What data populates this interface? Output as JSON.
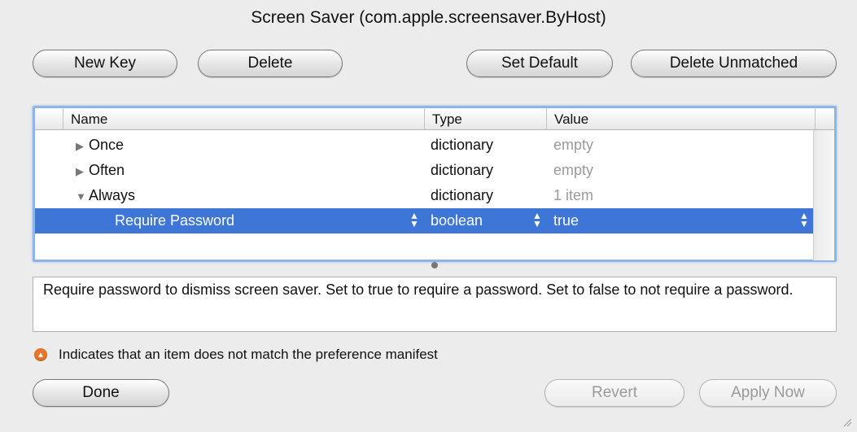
{
  "window": {
    "title": "Screen Saver (com.apple.screensaver.ByHost)"
  },
  "toolbar": {
    "new_key": "New Key",
    "delete": "Delete",
    "set_default": "Set Default",
    "delete_unmatched": "Delete Unmatched"
  },
  "table": {
    "columns": {
      "name": "Name",
      "type": "Type",
      "value": "Value"
    },
    "rows": [
      {
        "name": "Once",
        "type": "dictionary",
        "value": "empty",
        "expander": "collapsed"
      },
      {
        "name": "Often",
        "type": "dictionary",
        "value": "empty",
        "expander": "collapsed"
      },
      {
        "name": "Always",
        "type": "dictionary",
        "value": "1 item",
        "expander": "expanded"
      },
      {
        "name": "Require Password",
        "type": "boolean",
        "value": "true",
        "selected": true
      }
    ]
  },
  "description": "Require password to dismiss screen saver. Set to true to require a password. Set to false to not require a password.",
  "legend": {
    "text": "Indicates that an item does not match the preference manifest",
    "color": "#e8762c"
  },
  "footer": {
    "done": "Done",
    "revert": "Revert",
    "apply_now": "Apply Now"
  },
  "colors": {
    "selection": "#3d76d6",
    "focus_ring": "#8fb4e6"
  }
}
